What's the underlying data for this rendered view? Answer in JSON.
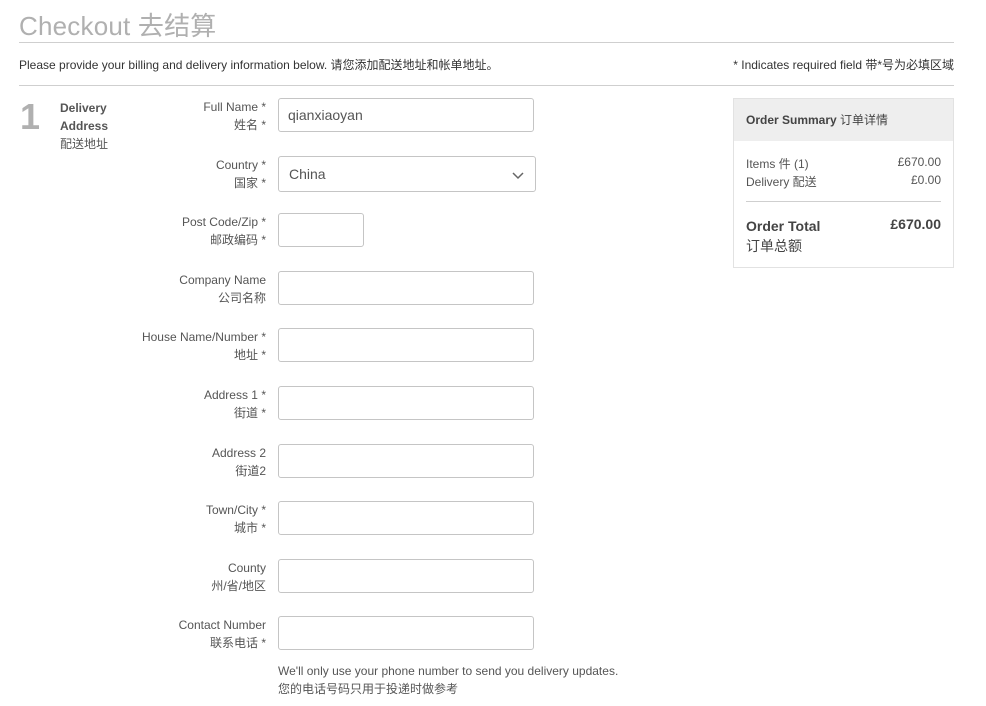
{
  "page": {
    "title": "Checkout 去结算",
    "intro": "Please provide your billing and delivery information below. 请您添加配送地址和帐单地址。",
    "required_note": "* Indicates required field 带*号为必填区域"
  },
  "step": {
    "number": "1",
    "title_line1": "Delivery",
    "title_line2": "Address",
    "title_zh": "配送地址"
  },
  "form": {
    "full_name": {
      "label": "Full Name *",
      "label_zh": "姓名 *",
      "value": "qianxiaoyan"
    },
    "country": {
      "label": "Country *",
      "label_zh": "国家 *",
      "value": "China"
    },
    "postcode": {
      "label": "Post Code/Zip *",
      "label_zh": "邮政编码 *",
      "value": ""
    },
    "company": {
      "label": "Company Name",
      "label_zh": "公司名称",
      "value": ""
    },
    "house": {
      "label": "House Name/Number *",
      "label_zh": "地址 *",
      "value": ""
    },
    "address1": {
      "label": "Address 1 *",
      "label_zh": "街道 *",
      "value": ""
    },
    "address2": {
      "label": "Address 2",
      "label_zh": "街道2",
      "value": ""
    },
    "town": {
      "label": "Town/City *",
      "label_zh": "城市 *",
      "value": ""
    },
    "county": {
      "label": "County",
      "label_zh": "州/省/地区",
      "value": ""
    },
    "contact": {
      "label": "Contact Number",
      "label_zh": "联系电话 *",
      "value": ""
    },
    "contact_help": "We'll only use your phone number to send you delivery updates.",
    "contact_help_zh": "您的电话号码只用于投递时做参考"
  },
  "summary": {
    "heading_bold": "Order Summary",
    "heading_zh": "订单详情",
    "items_label": "Items 件 (1)",
    "items_value": "£670.00",
    "delivery_label": "Delivery 配送",
    "delivery_value": "£0.00",
    "total_label": "Order Total",
    "total_label_zh": "订单总额",
    "total_value": "£670.00"
  }
}
